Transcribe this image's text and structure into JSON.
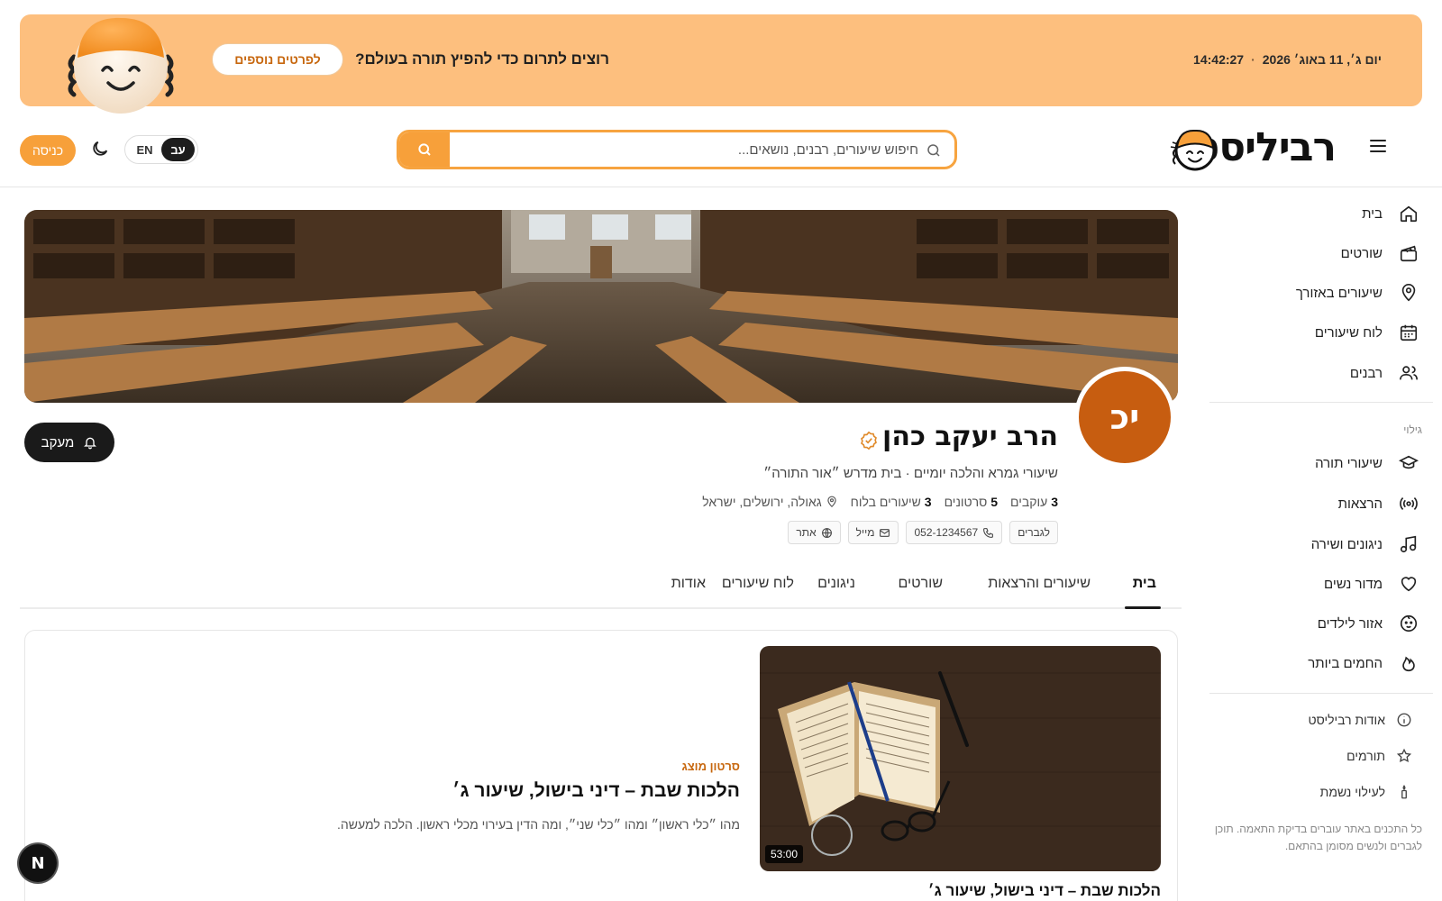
{
  "banner": {
    "date": "יום ג׳, 11 באוג׳ 2026",
    "time": "14:42:27",
    "question": "רוצים לתרום כדי להפיץ תורה בעולם?",
    "details_button": "לפרטים נוספים"
  },
  "header": {
    "logo": "רביליסט",
    "search_placeholder": "חיפוש שיעורים, רבנים, נושאים...",
    "lang_he": "עב",
    "lang_en": "EN",
    "login": "כניסה"
  },
  "sidebar": {
    "items": [
      {
        "label": "בית",
        "icon": "home-icon"
      },
      {
        "label": "שורטים",
        "icon": "clapperboard-icon"
      },
      {
        "label": "שיעורים באזורך",
        "icon": "map-pin-icon"
      },
      {
        "label": "לוח שיעורים",
        "icon": "calendar-icon"
      },
      {
        "label": "רבנים",
        "icon": "users-icon"
      }
    ],
    "discover_heading": "גילוי",
    "discover": [
      {
        "label": "שיעורי תורה",
        "icon": "graduation-cap-icon"
      },
      {
        "label": "הרצאות",
        "icon": "broadcast-icon"
      },
      {
        "label": "ניגונים ושירה",
        "icon": "music-icon"
      },
      {
        "label": "מדור נשים",
        "icon": "heart-icon"
      },
      {
        "label": "אזור לילדים",
        "icon": "baby-icon"
      },
      {
        "label": "החמים ביותר",
        "icon": "flame-icon"
      }
    ],
    "footer_links": [
      {
        "label": "אודות רביליסט",
        "icon": "info-icon"
      },
      {
        "label": "תורמים",
        "icon": "star-icon"
      },
      {
        "label": "לעילוי נשמת",
        "icon": "candle-icon"
      }
    ],
    "note": "כל התכנים באתר עוברים בדיקת התאמה. תוכן לגברים ולנשים מסומן בהתאם."
  },
  "profile": {
    "initials": "יכ",
    "name": "הרב יעקב כהן",
    "subtitle": "שיעורי גמרא והלכה יומיים · בית מדרש ״אור התורה״",
    "followers_count": "3",
    "followers_label": "עוקבים",
    "videos_count": "5",
    "videos_label": "סרטונים",
    "lessons_count": "3",
    "lessons_label": "שיעורים בלוח",
    "location": "גאולה, ירושלים, ישראל",
    "chip_men": "לגברים",
    "phone": "052-1234567",
    "email": "מייל",
    "website": "אתר",
    "follow_button": "מעקב"
  },
  "tabs": [
    "בית",
    "שיעורים והרצאות",
    "שורטים",
    "ניגונים",
    "לוח שיעורים",
    "אודות"
  ],
  "featured": {
    "kicker": "סרטון מוצג",
    "title": "הלכות שבת – דיני בישול, שיעור ג׳",
    "description": "מהו ״כלי ראשון״ ומהו ״כלי שני״, ומה הדין בעירוי מכלי ראשון. הלכה למעשה.",
    "duration": "53:00",
    "caption_title": "הלכות שבת – דיני בישול, שיעור ג׳"
  },
  "dev_badge": "N",
  "colors": {
    "accent": "#f7a03a",
    "banner_bg": "#fdbf7e",
    "avatar": "#c75d10",
    "kicker": "#c7670e"
  }
}
